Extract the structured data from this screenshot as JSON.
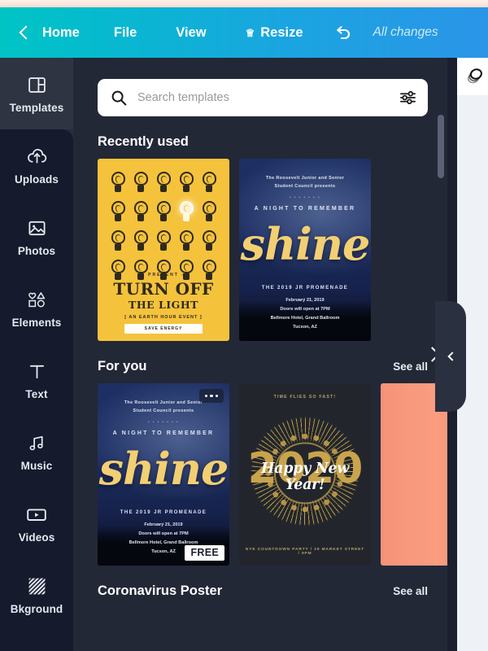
{
  "topbar": {
    "back_icon": "chevron-left-icon",
    "home": "Home",
    "file": "File",
    "view": "View",
    "crown_icon": "crown-icon",
    "resize": "Resize",
    "undo_icon": "undo-icon",
    "status": "All changes",
    "gradient_from": "#00c4c4",
    "gradient_to": "#2b95e8"
  },
  "sidebar": {
    "items": [
      {
        "label": "Templates",
        "icon": "templates-icon",
        "active": true
      },
      {
        "label": "Uploads",
        "icon": "cloud-upload-icon",
        "active": false
      },
      {
        "label": "Photos",
        "icon": "image-icon",
        "active": false
      },
      {
        "label": "Elements",
        "icon": "shapes-icon",
        "active": false
      },
      {
        "label": "Text",
        "icon": "text-icon",
        "active": false
      },
      {
        "label": "Music",
        "icon": "music-note-icon",
        "active": false
      },
      {
        "label": "Videos",
        "icon": "video-icon",
        "active": false
      },
      {
        "label": "Bkground",
        "icon": "hatch-pattern-icon",
        "active": false
      }
    ]
  },
  "search": {
    "placeholder": "Search templates",
    "value": "",
    "search_icon": "search-icon",
    "filter_icon": "filter-sliders-icon"
  },
  "sections": {
    "recently_used": {
      "title": "Recently used"
    },
    "for_you": {
      "title": "For you",
      "see_all": "See all"
    },
    "coronavirus": {
      "title": "Coronavirus Poster",
      "see_all": "See all"
    }
  },
  "posters": {
    "turn_off_light": {
      "present": "- PRESENT -",
      "title": "TURN OFF",
      "subtitle": "THE LIGHT",
      "tagline": "[ AN EARTH HOUR EVENT ]",
      "button": "SAVE ENERGY",
      "bulb_rows": 4,
      "bulb_cols": 5,
      "lit_index": 8,
      "bg_color": "#f5c23c"
    },
    "shine": {
      "line1": "The Roosevelt Junior and Senior",
      "line2": "Student Council presents",
      "ornament": "• • • • • • •",
      "night": "A NIGHT TO REMEMBER",
      "word": "shine",
      "prom": "THE 2019 JR PROMENADE",
      "divider": "— • —",
      "detail1": "February 21, 2019",
      "detail2": "Doors will open at 7PM",
      "detail3": "Bellmore Hotel, Grand Ballroom",
      "detail4": "Tucson, AZ",
      "free_badge": "FREE",
      "menu_icon": "more-options-icon"
    },
    "new_year": {
      "top": "TIME FLIES SO FAST!",
      "year": "2020",
      "greeting": "Happy New Year!",
      "bottom": "NYE COUNTDOWN PARTY / 26 MARKET STREET / 9PM"
    },
    "coral": {
      "next_icon": "chevron-right-icon"
    }
  },
  "canvas": {
    "layers_icon": "layers-icon",
    "collapse_icon": "chevron-left-icon"
  }
}
